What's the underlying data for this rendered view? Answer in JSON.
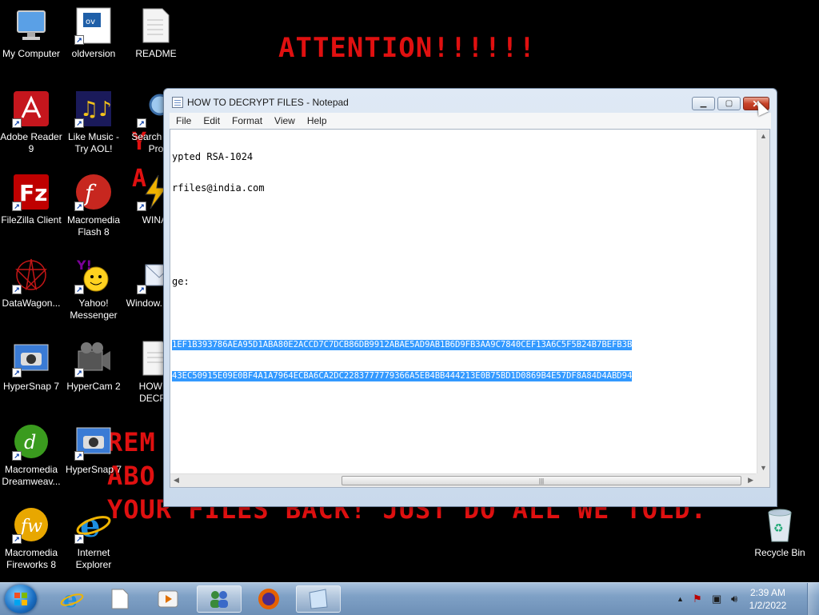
{
  "wallpaper": {
    "attention": "ATTENTION!!!!!!",
    "fragment_y": "Y",
    "fragment_a": "A",
    "fragment_rem": "REM",
    "fragment_abo": "ABO",
    "fragment_files": "YOUR FILES BACK! JUST DO ALL WE TOLD."
  },
  "desktop_icons": [
    {
      "label": "My Computer",
      "icon": "computer-icon"
    },
    {
      "label": "oldversion",
      "icon": "ov-document-icon"
    },
    {
      "label": "README",
      "icon": "text-file-icon"
    },
    {
      "label": "Adobe Reader 9",
      "icon": "adobe-reader-icon"
    },
    {
      "label": "Like Music - Try AOL!",
      "icon": "music-notes-icon"
    },
    {
      "label": "Search M... Pro",
      "icon": "search-magnifier-icon"
    },
    {
      "label": "FileZilla Client",
      "icon": "filezilla-icon"
    },
    {
      "label": "Macromedia Flash 8",
      "icon": "flash-icon"
    },
    {
      "label": "WINAI",
      "icon": "winamp-icon"
    },
    {
      "label": "DataWagon...",
      "icon": "datawagon-icon"
    },
    {
      "label": "Yahoo! Messenger",
      "icon": "yahoo-messenger-icon"
    },
    {
      "label": "Window... Mai",
      "icon": "windows-mail-icon"
    },
    {
      "label": "HyperSnap 7",
      "icon": "camera-icon"
    },
    {
      "label": "HyperCam 2",
      "icon": "film-camera-icon"
    },
    {
      "label": "HOW ... DECRY",
      "icon": "text-file-icon"
    },
    {
      "label": "Macromedia Dreamweav...",
      "icon": "dreamweaver-icon"
    },
    {
      "label": "HyperSnap 7",
      "icon": "camera-icon"
    },
    {
      "label": "Macromedia Fireworks 8",
      "icon": "fireworks-icon"
    },
    {
      "label": "Internet Explorer",
      "icon": "internet-explorer-icon"
    },
    {
      "label": "Recycle Bin",
      "icon": "recycle-bin-icon"
    }
  ],
  "notepad": {
    "title": "HOW TO DECRYPT FILES - Notepad",
    "menu": [
      "File",
      "Edit",
      "Format",
      "View",
      "Help"
    ],
    "lines": [
      "ypted RSA-1024",
      "rfiles@india.com",
      "",
      "",
      "ge:"
    ],
    "selected_lines": [
      "1EF1B393786AEA95D1ABA80E2ACCD7C7DCB86DB9912ABAE5AD9AB1B6D9FB3AA9C7840CEF13A6C5F5B24B7BEFB3B",
      "43EC50915E09E0BF4A1A7964ECBA6CA2DC2283777779366A5EB4BB444213E0B75BD1D0869B4E57DF8A84D4ABD94"
    ]
  },
  "taskbar": {
    "pinned": [
      {
        "icon": "internet-explorer-icon",
        "running": false
      },
      {
        "icon": "notepad-document-icon",
        "running": false
      },
      {
        "icon": "media-player-icon",
        "running": false
      },
      {
        "icon": "users-network-icon",
        "running": true
      },
      {
        "icon": "firefox-icon",
        "running": false
      },
      {
        "icon": "notepad-icon",
        "running": true
      }
    ],
    "clock_time": "2:39 AM",
    "clock_date": "1/2/2022"
  }
}
